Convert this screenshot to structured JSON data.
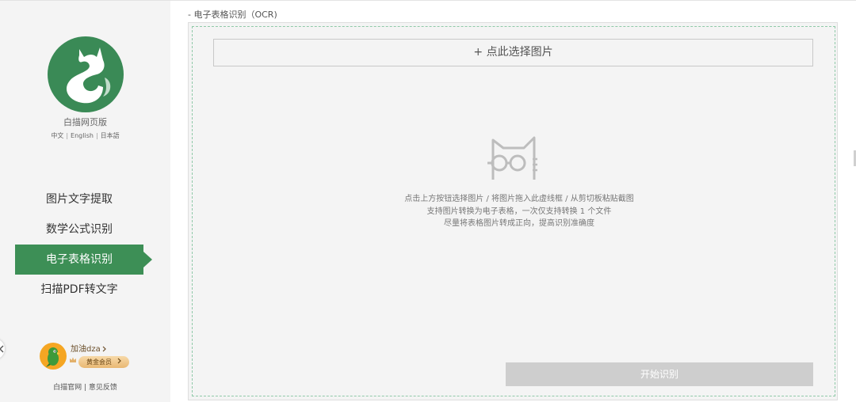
{
  "sidebar": {
    "brand_name": "白描网页版",
    "languages": [
      "中文",
      "English",
      "日本語"
    ],
    "language_separator": "|",
    "nav": [
      {
        "label": "图片文字提取",
        "active": false
      },
      {
        "label": "数学公式识别",
        "active": false
      },
      {
        "label": "电子表格识别",
        "active": true
      },
      {
        "label": "扫描PDF转文字",
        "active": false
      }
    ],
    "user": {
      "name": "加油dza",
      "badge": "黄金会员"
    },
    "footer_links": [
      "白描官网",
      "意见反馈"
    ],
    "footer_separator": " | "
  },
  "main": {
    "page_title": "- 电子表格识别（OCR)",
    "select_button_label": "+ 点此选择图片",
    "hints": [
      "点击上方按钮选择图片 / 将图片拖入此虚线框 / 从剪切板粘贴截图",
      "支持图片转换为电子表格，一次仅支持转换 1 个文件",
      "尽量将表格图片转成正向，提高识别准确度"
    ],
    "start_button_label": "开始识别"
  },
  "colors": {
    "accent": "#3d8f56",
    "logo_bg": "#3a8a56",
    "panel_bg": "#f4f4f4",
    "dashed_border": "#8fc9a8",
    "disabled_button": "#cecece",
    "vip_gold": "#e9b873"
  },
  "icons": {
    "logo": "cat-s-logo-icon",
    "empty_state": "cat-with-glasses-icon",
    "collapse": "chevron-left-icon",
    "username_arrow": "chevron-right-icon",
    "badge_arrow": "chevron-right-icon",
    "crown": "crown-icon"
  }
}
